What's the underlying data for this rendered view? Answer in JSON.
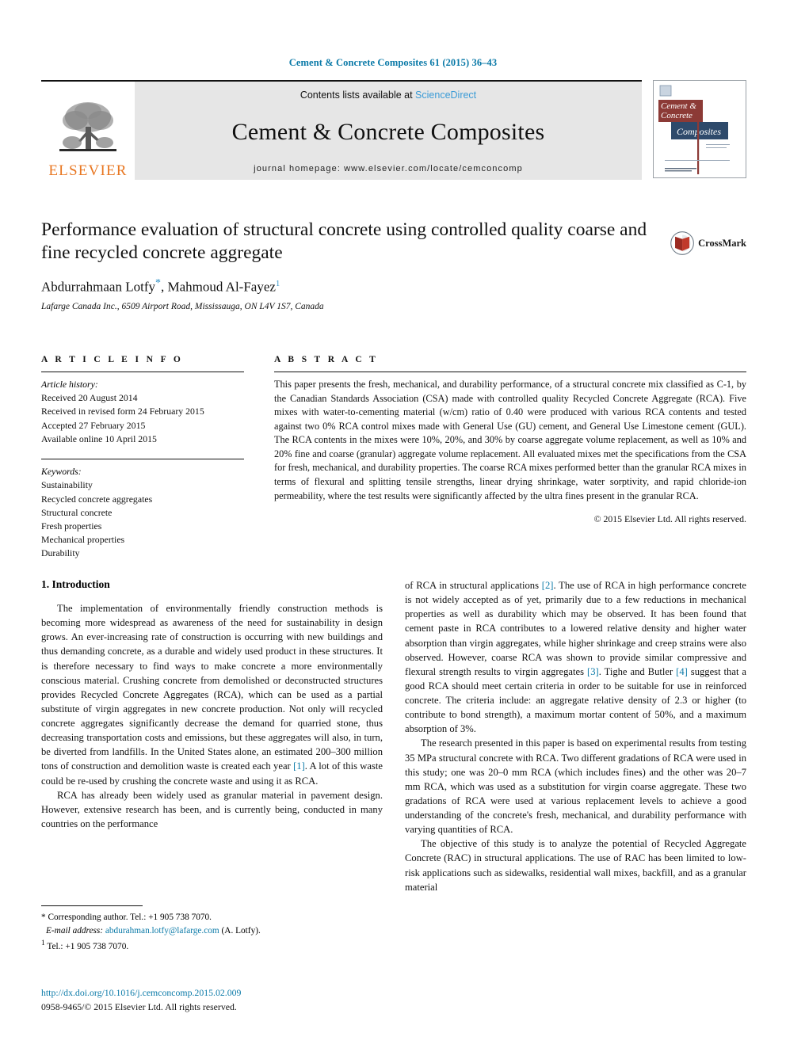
{
  "running_head": "Cement & Concrete Composites 61 (2015) 36–43",
  "masthead": {
    "publisher_name": "ELSEVIER",
    "contents_prefix": "Contents lists available at ",
    "contents_link": "ScienceDirect",
    "journal_title": "Cement & Concrete Composites",
    "homepage_line": "journal homepage: www.elsevier.com/locate/cemconcomp",
    "cover_title_line1": "Cement &",
    "cover_title_line2": "Concrete",
    "cover_title_line3": "Composites"
  },
  "article": {
    "title": "Performance evaluation of structural concrete using controlled quality coarse and fine recycled concrete aggregate",
    "author1": "Abdurrahmaan Lotfy",
    "author2": "Mahmoud Al-Fayez",
    "affiliation": "Lafarge Canada Inc., 6509 Airport Road, Mississauga, ON L4V 1S7, Canada",
    "crossmark_label": "CrossMark"
  },
  "article_info": {
    "heading": "A R T I C L E    I N F O",
    "history_label": "Article history:",
    "history": [
      "Received 20 August 2014",
      "Received in revised form 24 February 2015",
      "Accepted 27 February 2015",
      "Available online 10 April 2015"
    ],
    "keywords_label": "Keywords:",
    "keywords": [
      "Sustainability",
      "Recycled concrete aggregates",
      "Structural concrete",
      "Fresh properties",
      "Mechanical properties",
      "Durability"
    ]
  },
  "abstract": {
    "heading": "A B S T R A C T",
    "text": "This paper presents the fresh, mechanical, and durability performance, of a structural concrete mix classified as C-1, by the Canadian Standards Association (CSA) made with controlled quality Recycled Concrete Aggregate (RCA). Five mixes with water-to-cementing material (w/cm) ratio of 0.40 were produced with various RCA contents and tested against two 0% RCA control mixes made with General Use (GU) cement, and General Use Limestone cement (GUL). The RCA contents in the mixes were 10%, 20%, and 30% by coarse aggregate volume replacement, as well as 10% and 20% fine and coarse (granular) aggregate volume replacement. All evaluated mixes met the specifications from the CSA for fresh, mechanical, and durability properties. The coarse RCA mixes performed better than the granular RCA mixes in terms of flexural and splitting tensile strengths, linear drying shrinkage, water sorptivity, and rapid chloride-ion permeability, where the test results were significantly affected by the ultra fines present in the granular RCA.",
    "copyright": "© 2015 Elsevier Ltd. All rights reserved."
  },
  "introduction": {
    "heading": "1. Introduction",
    "left_paragraphs": [
      "The implementation of environmentally friendly construction methods is becoming more widespread as awareness of the need for sustainability in design grows. An ever-increasing rate of construction is occurring with new buildings and thus demanding concrete, as a durable and widely used product in these structures. It is therefore necessary to find ways to make concrete a more environmentally conscious material. Crushing concrete from demolished or deconstructed structures provides Recycled Concrete Aggregates (RCA), which can be used as a partial substitute of virgin aggregates in new concrete production. Not only will recycled concrete aggregates significantly decrease the demand for quarried stone, thus decreasing transportation costs and emissions, but these aggregates will also, in turn, be diverted from landfills. In the United States alone, an estimated 200–300 million tons of construction and demolition waste is created each year [1]. A lot of this waste could be re-used by crushing the concrete waste and using it as RCA.",
      "RCA has already been widely used as granular material in pavement design. However, extensive research has been, and is currently being, conducted in many countries on the performance"
    ],
    "right_paragraphs": [
      "of RCA in structural applications [2]. The use of RCA in high performance concrete is not widely accepted as of yet, primarily due to a few reductions in mechanical properties as well as durability which may be observed. It has been found that cement paste in RCA contributes to a lowered relative density and higher water absorption than virgin aggregates, while higher shrinkage and creep strains were also observed. However, coarse RCA was shown to provide similar compressive and flexural strength results to virgin aggregates [3]. Tighe and Butler [4] suggest that a good RCA should meet certain criteria in order to be suitable for use in reinforced concrete. The criteria include: an aggregate relative density of 2.3 or higher (to contribute to bond strength), a maximum mortar content of 50%, and a maximum absorption of 3%.",
      "The research presented in this paper is based on experimental results from testing 35 MPa structural concrete with RCA. Two different gradations of RCA were used in this study; one was 20–0 mm RCA (which includes fines) and the other was 20–7 mm RCA, which was used as a substitution for virgin coarse aggregate. These two gradations of RCA were used at various replacement levels to achieve a good understanding of the concrete's fresh, mechanical, and durability performance with varying quantities of RCA.",
      "The objective of this study is to analyze the potential of Recycled Aggregate Concrete (RAC) in structural applications. The use of RAC has been limited to low-risk applications such as sidewalks, residential wall mixes, backfill, and as a granular material"
    ]
  },
  "footnotes": {
    "corresponding": "Corresponding author. Tel.: +1 905 738 7070.",
    "email_label": "E-mail address:",
    "email": "abdurahman.lotfy@lafarge.com",
    "email_suffix": "(A. Lotfy).",
    "tel_note": "Tel.: +1 905 738 7070."
  },
  "footer": {
    "doi": "http://dx.doi.org/10.1016/j.cemconcomp.2015.02.009",
    "issn_line": "0958-9465/© 2015 Elsevier Ltd. All rights reserved."
  },
  "colors": {
    "link_blue": "#0b7aa8",
    "sciencedirect_blue": "#3a9bd6",
    "elsevier_orange": "#E87722",
    "band_grey": "#e6e6e6",
    "cover_maroon": "#8c3a36",
    "cover_navy": "#2e4a6b"
  }
}
